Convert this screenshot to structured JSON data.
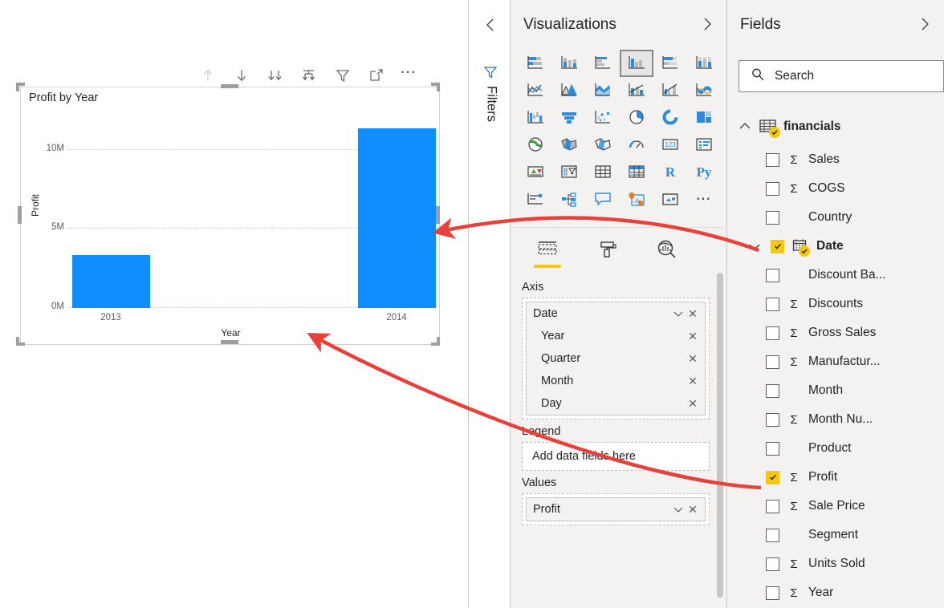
{
  "canvas": {
    "visual": {
      "title": "Profit by Year",
      "toolbar": [
        {
          "name": "drill-up-icon",
          "label": "Drill Up",
          "disabled": true
        },
        {
          "name": "drill-down-icon",
          "label": "Drill Down",
          "disabled": false
        },
        {
          "name": "expand-all-icon",
          "label": "Expand all down one level in the hierarchy",
          "disabled": false
        },
        {
          "name": "drill-mode-icon",
          "label": "Go to the next level in the hierarchy",
          "disabled": false
        },
        {
          "name": "filter-icon",
          "label": "Filters",
          "disabled": false
        },
        {
          "name": "focus-mode-icon",
          "label": "Focus mode",
          "disabled": false
        },
        {
          "name": "more-options-icon",
          "label": "More options",
          "disabled": false
        }
      ]
    }
  },
  "chart_data": {
    "type": "bar",
    "title": "Profit by Year",
    "categories": [
      "2013",
      "2014"
    ],
    "values": [
      3300000,
      11300000
    ],
    "xlabel": "Year",
    "ylabel": "Profit",
    "ytick_labels": [
      "0M",
      "5M",
      "10M"
    ],
    "ytick_values": [
      0,
      5000000,
      10000000
    ],
    "ylim": [
      0,
      12900000
    ],
    "grid": true,
    "legend": "none",
    "series_color": "#118DFF"
  },
  "filters_pane": {
    "collapse_icon": "chevron-left-icon",
    "funnel_icon": "filter-funnel-icon",
    "label": "Filters"
  },
  "visualizations": {
    "title": "Visualizations",
    "expand_icon": "chevron-right-icon",
    "gallery": [
      {
        "name": "stacked-bar-chart-icon",
        "label": "Stacked bar chart",
        "selected": false
      },
      {
        "name": "stacked-column-chart-icon",
        "label": "Stacked column chart",
        "selected": false
      },
      {
        "name": "clustered-bar-chart-icon",
        "label": "Clustered bar chart",
        "selected": false
      },
      {
        "name": "clustered-column-chart-icon",
        "label": "Clustered column chart",
        "selected": true
      },
      {
        "name": "hundred-percent-stacked-bar-chart-icon",
        "label": "100% Stacked bar chart",
        "selected": false
      },
      {
        "name": "hundred-percent-stacked-column-chart-icon",
        "label": "100% Stacked column chart",
        "selected": false
      },
      {
        "name": "line-chart-icon",
        "label": "Line chart",
        "selected": false
      },
      {
        "name": "area-chart-icon",
        "label": "Area chart",
        "selected": false
      },
      {
        "name": "stacked-area-chart-icon",
        "label": "Stacked area chart",
        "selected": false
      },
      {
        "name": "line-and-stacked-column-chart-icon",
        "label": "Line and stacked column chart",
        "selected": false
      },
      {
        "name": "line-and-clustered-column-chart-icon",
        "label": "Line and clustered column chart",
        "selected": false
      },
      {
        "name": "ribbon-chart-icon",
        "label": "Ribbon chart",
        "selected": false
      },
      {
        "name": "waterfall-chart-icon",
        "label": "Waterfall chart",
        "selected": false
      },
      {
        "name": "funnel-chart-icon",
        "label": "Funnel chart",
        "selected": false
      },
      {
        "name": "scatter-chart-icon",
        "label": "Scatter chart",
        "selected": false
      },
      {
        "name": "pie-chart-icon",
        "label": "Pie chart",
        "selected": false
      },
      {
        "name": "donut-chart-icon",
        "label": "Donut chart",
        "selected": false
      },
      {
        "name": "treemap-icon",
        "label": "Treemap",
        "selected": false
      },
      {
        "name": "map-icon",
        "label": "Map",
        "selected": false
      },
      {
        "name": "filled-map-icon",
        "label": "Filled map",
        "selected": false
      },
      {
        "name": "shape-map-icon",
        "label": "Shape map",
        "selected": false
      },
      {
        "name": "gauge-icon",
        "label": "Gauge",
        "selected": false
      },
      {
        "name": "card-icon",
        "label": "Card",
        "selected": false
      },
      {
        "name": "multi-row-card-icon",
        "label": "Multi-row card",
        "selected": false
      },
      {
        "name": "kpi-icon",
        "label": "KPI",
        "selected": false
      },
      {
        "name": "slicer-icon",
        "label": "Slicer",
        "selected": false
      },
      {
        "name": "table-icon",
        "label": "Table",
        "selected": false
      },
      {
        "name": "matrix-icon",
        "label": "Matrix",
        "selected": false
      },
      {
        "name": "r-script-visual-icon",
        "label": "R",
        "selected": false
      },
      {
        "name": "python-visual-icon",
        "label": "Py",
        "selected": false
      },
      {
        "name": "key-influencers-icon",
        "label": "Key influencers",
        "selected": false
      },
      {
        "name": "decomposition-tree-icon",
        "label": "Decomposition tree",
        "selected": false
      },
      {
        "name": "qna-visual-icon",
        "label": "Q&A",
        "selected": false
      },
      {
        "name": "arcgis-maps-icon",
        "label": "ArcGIS Maps for Power BI",
        "selected": false
      },
      {
        "name": "paginated-report-icon",
        "label": "Paginated report",
        "selected": false
      },
      {
        "name": "get-more-visuals-icon",
        "label": "More options",
        "selected": false
      }
    ],
    "tabs": [
      {
        "name": "tab-fields",
        "label": "Fields",
        "icon": "fields-table-icon",
        "active": true
      },
      {
        "name": "tab-format",
        "label": "Format",
        "icon": "paint-roller-icon",
        "active": false
      },
      {
        "name": "tab-analytics",
        "label": "Analytics",
        "icon": "analytics-magnifier-icon",
        "active": false
      }
    ],
    "wells": [
      {
        "name": "axis",
        "label": "Axis",
        "empty": false,
        "items": [
          {
            "label": "Date",
            "child": false,
            "has_chevron": true
          },
          {
            "label": "Year",
            "child": true,
            "has_chevron": false
          },
          {
            "label": "Quarter",
            "child": true,
            "has_chevron": false
          },
          {
            "label": "Month",
            "child": true,
            "has_chevron": false
          },
          {
            "label": "Day",
            "child": true,
            "has_chevron": false
          }
        ]
      },
      {
        "name": "legend",
        "label": "Legend",
        "empty": true,
        "placeholder": "Add data fields here",
        "items": []
      },
      {
        "name": "values",
        "label": "Values",
        "empty": false,
        "items": [
          {
            "label": "Profit",
            "child": false,
            "has_chevron": true
          }
        ]
      }
    ]
  },
  "fields": {
    "title": "Fields",
    "expand_icon": "chevron-right-icon",
    "search": {
      "placeholder": "Search",
      "value": "",
      "icon": "search-icon"
    },
    "table": {
      "name": "financials",
      "expanded": true,
      "icon": "table-grid-icon",
      "badge": "check-badge-icon"
    },
    "items": [
      {
        "label": "Sigma",
        "name": "Sales",
        "checked": false,
        "numeric": true,
        "expandable": false,
        "bold": false
      },
      {
        "label": "Sigma",
        "name": "COGS",
        "checked": false,
        "numeric": true,
        "expandable": false,
        "bold": false
      },
      {
        "label": "",
        "name": "Country",
        "checked": false,
        "numeric": false,
        "expandable": false,
        "bold": false
      },
      {
        "label": "",
        "name": "Date",
        "checked": true,
        "numeric": false,
        "expandable": true,
        "bold": true,
        "icon": "calendar-icon",
        "badge": true
      },
      {
        "label": "",
        "name": "Discount Ba...",
        "checked": false,
        "numeric": false,
        "expandable": false,
        "bold": false
      },
      {
        "label": "Sigma",
        "name": "Discounts",
        "checked": false,
        "numeric": true,
        "expandable": false,
        "bold": false
      },
      {
        "label": "Sigma",
        "name": "Gross Sales",
        "checked": false,
        "numeric": true,
        "expandable": false,
        "bold": false
      },
      {
        "label": "Sigma",
        "name": "Manufactur...",
        "checked": false,
        "numeric": true,
        "expandable": false,
        "bold": false
      },
      {
        "label": "",
        "name": "Month",
        "checked": false,
        "numeric": false,
        "expandable": false,
        "bold": false
      },
      {
        "label": "Sigma",
        "name": "Month Nu...",
        "checked": false,
        "numeric": true,
        "expandable": false,
        "bold": false
      },
      {
        "label": "",
        "name": "Product",
        "checked": false,
        "numeric": false,
        "expandable": false,
        "bold": false
      },
      {
        "label": "Sigma",
        "name": "Profit",
        "checked": true,
        "numeric": true,
        "expandable": false,
        "bold": false
      },
      {
        "label": "Sigma",
        "name": "Sale Price",
        "checked": false,
        "numeric": true,
        "expandable": false,
        "bold": false
      },
      {
        "label": "",
        "name": "Segment",
        "checked": false,
        "numeric": false,
        "expandable": false,
        "bold": false
      },
      {
        "label": "Sigma",
        "name": "Units Sold",
        "checked": false,
        "numeric": true,
        "expandable": false,
        "bold": false
      },
      {
        "label": "Sigma",
        "name": "Year",
        "checked": false,
        "numeric": true,
        "expandable": false,
        "bold": false
      }
    ]
  },
  "annotations": {
    "color": "#E8413A",
    "arrows": [
      {
        "name": "arrow-date-to-chart",
        "from": "Date field",
        "to": "chart bar"
      },
      {
        "name": "arrow-profit-to-axis",
        "from": "Profit field",
        "to": "chart axis"
      }
    ]
  },
  "colors": {
    "bar": "#118DFF",
    "accent_yellow": "#F2C811",
    "pane_bg": "#f3f2f1",
    "annotation_red": "#E8413A"
  }
}
